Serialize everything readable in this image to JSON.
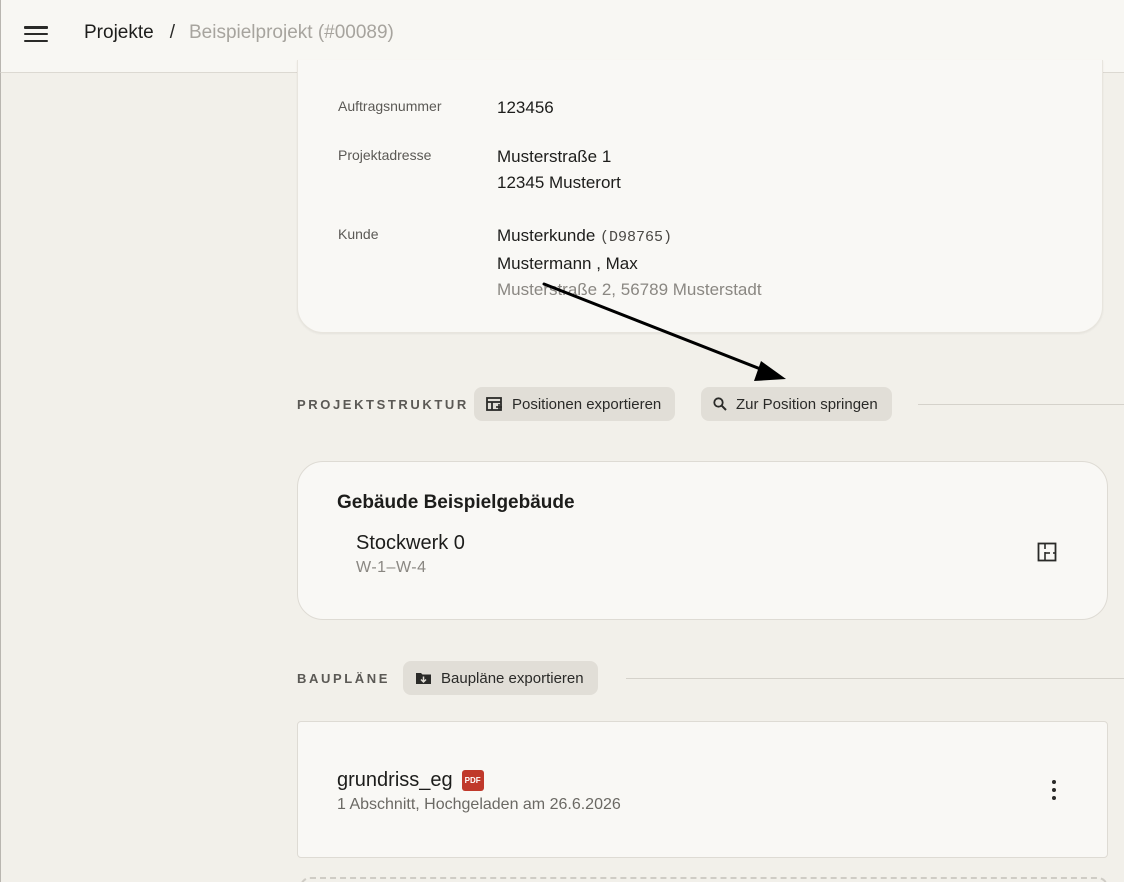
{
  "header": {
    "breadcrumb_root": "Projekte",
    "breadcrumb_sep": "/",
    "breadcrumb_current": "Beispielprojekt (#00089)"
  },
  "project": {
    "order_label": "Auftragsnummer",
    "order_value": "123456",
    "address_label": "Projektadresse",
    "address_line1": "Musterstraße 1",
    "address_line2": "12345 Musterort",
    "customer_label": "Kunde",
    "customer_name": "Musterkunde",
    "customer_id": "(D98765)",
    "customer_contact": "Mustermann , Max",
    "customer_address": "Musterstraße 2, 56789 Musterstadt"
  },
  "structure": {
    "section_label": "PROJEKTSTRUKTUR",
    "export_label": "Positionen exportieren",
    "jump_label": "Zur Position springen",
    "building_title": "Gebäude Beispielgebäude",
    "floor_name": "Stockwerk 0",
    "floor_sub": "W-1–W-4"
  },
  "plans": {
    "section_label": "BAUPLÄNE",
    "export_label": "Baupläne exportieren",
    "items": [
      {
        "name": "grundriss_eg",
        "badge": "PDF",
        "subtitle": "1 Abschnitt, Hochgeladen am 26.6.2026"
      }
    ]
  },
  "colors": {
    "background": "#f2f0ea",
    "card": "#f9f8f5",
    "chip": "#e1ded7",
    "pdf_badge": "#c0392b"
  }
}
